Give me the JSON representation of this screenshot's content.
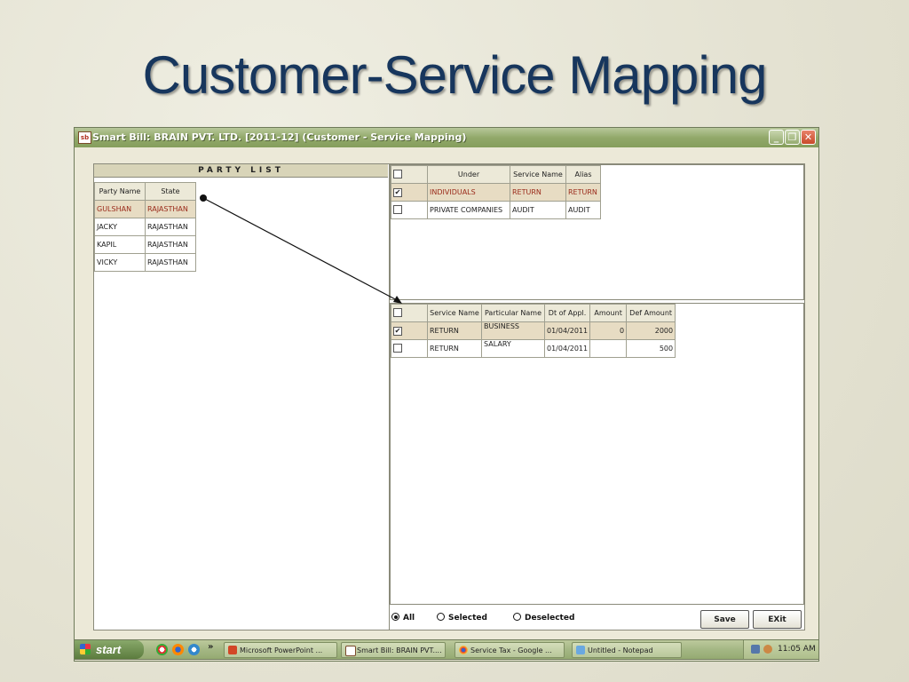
{
  "slide": {
    "title": "Customer-Service Mapping"
  },
  "window": {
    "title": "Smart Bill: BRAIN PVT. LTD. [2011-12]  (Customer - Service Mapping)",
    "app_icon": "sb",
    "minimize": "_",
    "restore": "❐",
    "close": "✕"
  },
  "party_list": {
    "header": "PARTY LIST",
    "columns": [
      "Party Name",
      "State"
    ],
    "rows": [
      {
        "name": "GULSHAN",
        "state": "RAJASTHAN",
        "selected": true
      },
      {
        "name": "JACKY",
        "state": "RAJASTHAN"
      },
      {
        "name": "KAPIL",
        "state": "RAJASTHAN"
      },
      {
        "name": "VICKY",
        "state": "RAJASTHAN"
      }
    ]
  },
  "upper_grid": {
    "columns": [
      "",
      "Under",
      "Service Name",
      "Alias"
    ],
    "rows": [
      {
        "checked": "✔",
        "under": "INDIVIDUALS",
        "service": "RETURN",
        "alias": "RETURN"
      },
      {
        "checked": "",
        "under": "PRIVATE COMPANIES",
        "service": "AUDIT",
        "alias": "AUDIT"
      }
    ]
  },
  "lower_grid": {
    "columns": [
      "",
      "Service Name",
      "Particular Name",
      "Dt of Appl.",
      "Amount",
      "Def Amount"
    ],
    "rows": [
      {
        "checked": "✔",
        "service": "RETURN",
        "particular": "BUSINESS",
        "date": "01/04/2011",
        "amount": "0",
        "def_amount": "2000"
      },
      {
        "checked": "",
        "service": "RETURN",
        "particular": "SALARY",
        "date": "01/04/2011",
        "amount": "",
        "def_amount": "500"
      }
    ]
  },
  "filter": {
    "all": "All",
    "selected": "Selected",
    "deselected": "Deselected",
    "active": "all"
  },
  "buttons": {
    "save": "Save",
    "exit": "EXit"
  },
  "taskbar": {
    "start": "start",
    "more": "»",
    "items": [
      "Microsoft PowerPoint ...",
      "Smart Bill: BRAIN PVT....",
      "Service Tax - Google ...",
      "Untitled - Notepad"
    ],
    "clock": "11:05 AM"
  },
  "colors": {
    "title": "#17365d",
    "selected_row_bg": "#e7dcc3",
    "selected_row_text": "#9a2a1a",
    "titlebar": "#92a96a"
  }
}
